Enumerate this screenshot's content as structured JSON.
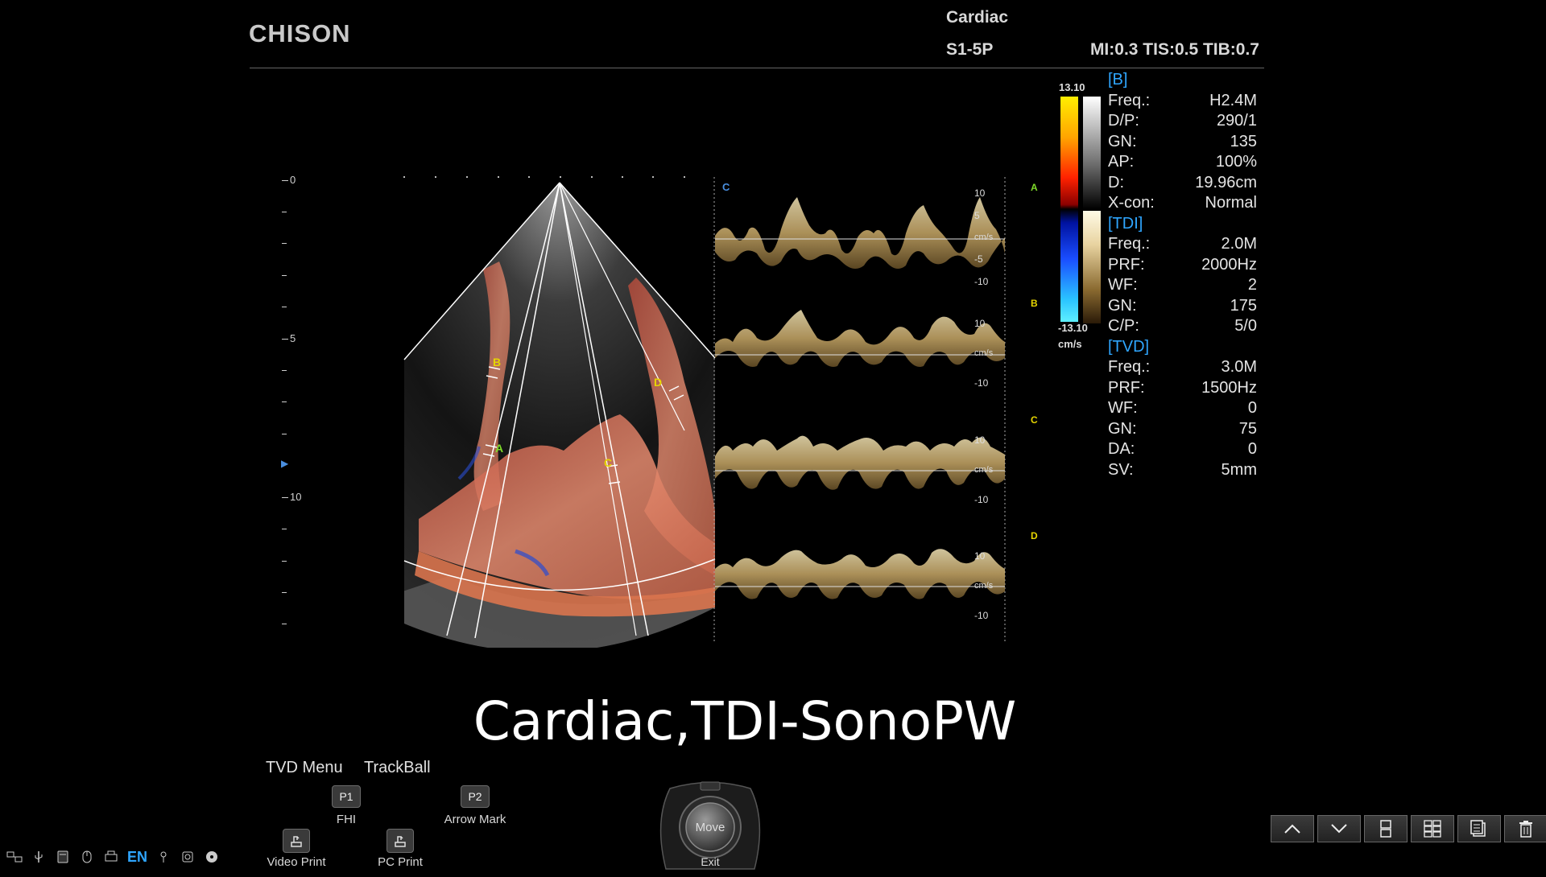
{
  "header": {
    "brand": "CHISON",
    "preset": "Cardiac",
    "probe": "S1-5P",
    "indices": "MI:0.3 TIS:0.5 TIB:0.7"
  },
  "depth_scale": {
    "labels": [
      "0",
      "5",
      "10"
    ],
    "focus_marker": "▶"
  },
  "sample_markers": [
    "A",
    "B",
    "C",
    "D"
  ],
  "trace_panel": {
    "corner_label": "C",
    "channels": [
      {
        "letter": "A",
        "ticks": [
          "10",
          "5",
          "cm/s",
          "-5",
          "-10"
        ]
      },
      {
        "letter": "B",
        "ticks": [
          "10",
          "cm/s",
          "-10"
        ]
      },
      {
        "letter": "C",
        "ticks": [
          "10",
          "cm/s",
          "-10"
        ]
      },
      {
        "letter": "D",
        "ticks": [
          "10",
          "cm/s",
          "-10"
        ]
      }
    ]
  },
  "colorbar": {
    "max": "13.10",
    "min": "-13.10",
    "unit": "cm/s"
  },
  "params": {
    "b": {
      "title": "[B]",
      "rows": [
        {
          "k": "Freq.:",
          "v": "H2.4M"
        },
        {
          "k": "D/P:",
          "v": "290/1"
        },
        {
          "k": "GN:",
          "v": "135"
        },
        {
          "k": "AP:",
          "v": "100%"
        },
        {
          "k": "D:",
          "v": "19.96cm"
        },
        {
          "k": "X-con:",
          "v": "Normal"
        }
      ]
    },
    "tdi": {
      "title": "[TDI]",
      "rows": [
        {
          "k": "Freq.:",
          "v": "2.0M"
        },
        {
          "k": "PRF:",
          "v": "2000Hz"
        },
        {
          "k": "WF:",
          "v": "2"
        },
        {
          "k": "GN:",
          "v": "175"
        },
        {
          "k": "C/P:",
          "v": "5/0"
        }
      ]
    },
    "tvd": {
      "title": "[TVD]",
      "rows": [
        {
          "k": "Freq.:",
          "v": "3.0M"
        },
        {
          "k": "PRF:",
          "v": "1500Hz"
        },
        {
          "k": "WF:",
          "v": "0"
        },
        {
          "k": "GN:",
          "v": "75"
        },
        {
          "k": "DA:",
          "v": "0"
        },
        {
          "k": "SV:",
          "v": "5mm"
        }
      ]
    }
  },
  "caption": "Cardiac,TDI-SonoPW",
  "menu": {
    "tvd_menu": "TVD Menu",
    "trackball": "TrackBall",
    "p1_key": "P1",
    "p1_label": "FHI",
    "p2_key": "P2",
    "p2_label": "Arrow Mark",
    "video_print": "Video Print",
    "pc_print": "PC Print"
  },
  "trackball": {
    "center": "Move",
    "bottom": "Exit"
  },
  "status_bar": {
    "language": "EN",
    "icons": [
      "network-icon",
      "usb-icon",
      "storage-icon",
      "mouse-icon",
      "printer-icon",
      "language-indicator",
      "usb-key-icon",
      "wireless-icon",
      "disc-icon"
    ]
  },
  "nav_buttons": [
    "page-up-icon",
    "page-down-icon",
    "layout-dual-icon",
    "layout-quad-icon",
    "list-icon",
    "delete-icon"
  ],
  "colors": {
    "accent": "#2fa6ff",
    "marker_yellow": "#e6d500",
    "marker_green": "#7fdc2a"
  }
}
